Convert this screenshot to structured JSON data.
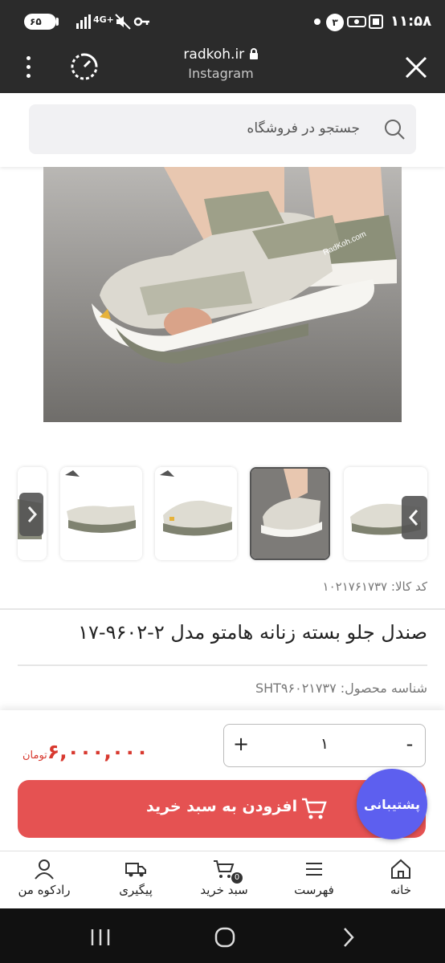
{
  "status_bar": {
    "time": "۱۱:۵۸",
    "battery": "۶۵",
    "network": "4G+",
    "notif_count": "۳"
  },
  "browser": {
    "domain": "radkoh.ir",
    "title": "Instagram"
  },
  "search": {
    "placeholder": "جستجو در فروشگاه"
  },
  "product": {
    "sku_label": "کد کالا: ۱۰۲۱۷۶۱۷۳۷",
    "title": "صندل جلو بسته زنانه هامتو مدل ۲-۹۶۰۲-۱۷",
    "product_id_label": "شناسه محصول: SHT۹۶۰۲۱۷۳۷",
    "quantity": "۱",
    "price": "۶,۰۰۰,۰۰۰",
    "currency": "تومان",
    "add_to_cart": "افزودن به سبد خرید",
    "support": "پشتیبانی"
  },
  "qty_controls": {
    "minus": "-",
    "plus": "+"
  },
  "bottom_nav": {
    "home": "خانه",
    "menu": "فهرست",
    "cart": "سبد خرید",
    "cart_count": "0",
    "tracking": "پیگیری",
    "account": "رادکوه من"
  },
  "colors": {
    "accent_red": "#e55252",
    "price_red": "#d8392f",
    "support_purple": "#5d5fef"
  },
  "icons": [
    "battery-icon",
    "wifi-icon",
    "mute-icon",
    "key-icon",
    "record-icon",
    "screen-icon",
    "menu-dots-icon",
    "reload-icon",
    "lock-icon",
    "close-icon",
    "search-icon",
    "chevron-left-icon",
    "chevron-right-icon",
    "cart-icon",
    "home-icon",
    "list-icon",
    "truck-icon",
    "user-icon",
    "back-icon",
    "home-circle-icon",
    "recents-icon"
  ]
}
